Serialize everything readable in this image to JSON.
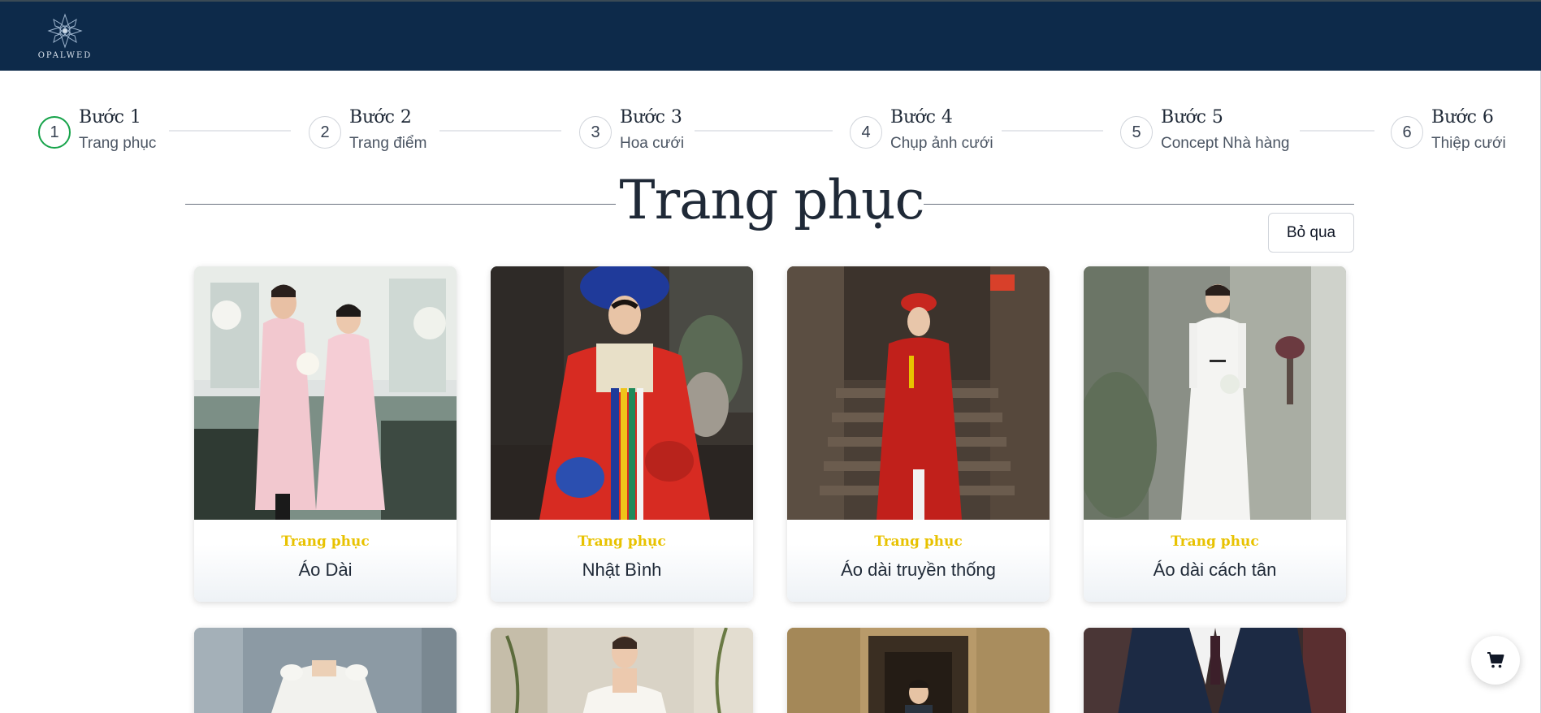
{
  "header": {
    "logo_text": "OPALWED"
  },
  "stepper": {
    "steps": [
      {
        "number": "1",
        "title": "Bước 1",
        "desc": "Trang phục",
        "active": true
      },
      {
        "number": "2",
        "title": "Bước 2",
        "desc": "Trang điểm",
        "active": false
      },
      {
        "number": "3",
        "title": "Bước 3",
        "desc": "Hoa cưới",
        "active": false
      },
      {
        "number": "4",
        "title": "Bước 4",
        "desc": "Chụp ảnh cưới",
        "active": false
      },
      {
        "number": "5",
        "title": "Bước 5",
        "desc": "Concept Nhà hàng",
        "active": false
      },
      {
        "number": "6",
        "title": "Bước 6",
        "desc": "Thiệp cưới",
        "active": false
      }
    ]
  },
  "section": {
    "title": "Trang phục",
    "skip_label": "Bỏ qua"
  },
  "cards": [
    {
      "category": "Trang phục",
      "name": "Áo Dài"
    },
    {
      "category": "Trang phục",
      "name": "Nhật Bình"
    },
    {
      "category": "Trang phục",
      "name": "Áo dài truyền thống"
    },
    {
      "category": "Trang phục",
      "name": "Áo dài cách tân"
    }
  ],
  "colors": {
    "header_bg": "#0d2a4a",
    "accent_gold": "#e8c200",
    "active_step": "#16a34a"
  },
  "cart": {
    "icon": "cart-icon"
  }
}
